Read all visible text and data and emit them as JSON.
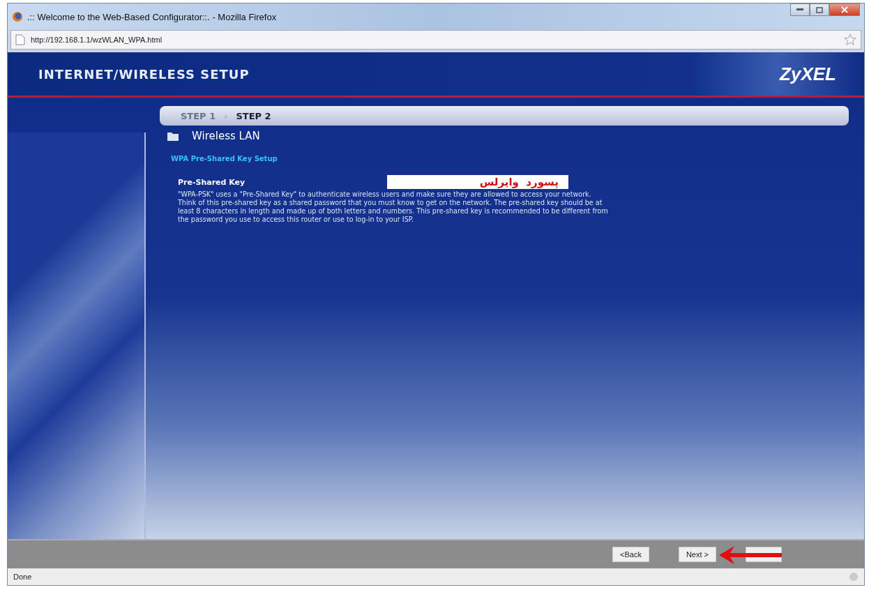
{
  "window": {
    "title": ".:: Welcome to the Web-Based Configurator::. - Mozilla Firefox"
  },
  "address_bar": {
    "url": "http://192.168.1.1/wzWLAN_WPA.html"
  },
  "header": {
    "title": "INTERNET/WIRELESS SETUP",
    "logo": "ZyXEL"
  },
  "steps": [
    {
      "label": "STEP 1",
      "selected": false
    },
    {
      "label": "STEP 2",
      "selected": true
    }
  ],
  "step_separator": "›",
  "section": {
    "title": "Wireless LAN",
    "subtitle": "WPA Pre-Shared Key Setup"
  },
  "field": {
    "label": "Pre-Shared Key",
    "value": "پسورد  وایرلس"
  },
  "description": [
    "\"WPA-PSK\" uses a \"Pre-Shared Key\" to authenticate wireless users and make sure they are allowed to access your network.",
    "Think of this pre-shared key as a shared password that you must know to get on the network. The pre-shared key should be at",
    "least 8 characters in length and made up of both letters and numbers. This pre-shared key is recommended to be different from",
    "the password you use to access this router or use to log-in to your ISP."
  ],
  "buttons": [
    {
      "label": "<Back"
    },
    {
      "label": "Next >"
    }
  ],
  "status_bar": "Done"
}
